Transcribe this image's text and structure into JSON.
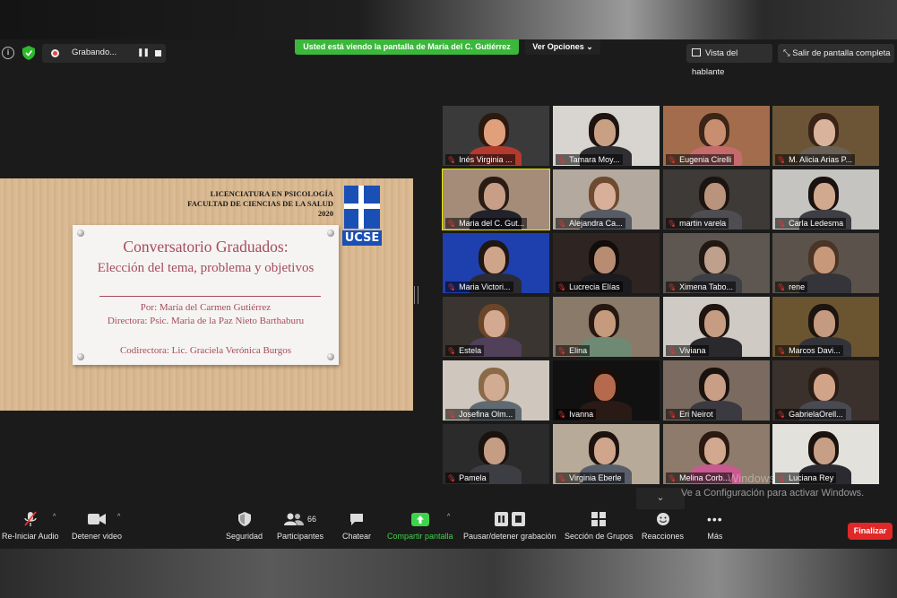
{
  "top_bar": {
    "recording_label": "Grabando...",
    "viewing_banner": "Usted está viendo la pantalla de María del C. Gutiérrez",
    "view_options": "Ver Opciones",
    "speaker_view": "Vista del hablante",
    "exit_fullscreen": "Salir de pantalla completa"
  },
  "slide": {
    "header_line1": "LICENCIATURA EN PSICOLOGÍA",
    "header_line2": "FACULTAD DE CIENCIAS DE LA SALUD",
    "header_year": "2020",
    "logo_text": "UCSE",
    "title": "Conversatorio Graduados:",
    "subtitle": "Elección del tema, problema y objetivos",
    "author": "Por: María del Carmen Gutiérrez",
    "director": "Directora: Psic. Maria de la Paz Nieto Barthaburu",
    "codirector": "Codirectora: Lic. Graciela Verónica Burgos"
  },
  "participants": [
    {
      "name": "Inés Virginia ...",
      "bg": "#3a3a3a",
      "skin": "#e1a07c",
      "hair": "#2b1a10",
      "shirt": "#b23a2f",
      "active": false
    },
    {
      "name": "Tamara Moy...",
      "bg": "#d8d4cf",
      "skin": "#caa085",
      "hair": "#1d1410",
      "shirt": "#2f2f33",
      "active": false
    },
    {
      "name": "Eugenia Cirelli",
      "bg": "#a36d4d",
      "skin": "#c78e70",
      "hair": "#3b2418",
      "shirt": "#c66b6b",
      "active": false
    },
    {
      "name": "M. Alicia Arias P...",
      "bg": "#6c5536",
      "skin": "#d9b39b",
      "hair": "#3a2418",
      "shirt": "#6a6055",
      "active": false
    },
    {
      "name": "Maria del C. Gut...",
      "bg": "#a58c78",
      "skin": "#c89e87",
      "hair": "#2a1c15",
      "shirt": "#22222a",
      "active": true
    },
    {
      "name": "Alejandra Ca...",
      "bg": "#b4a99e",
      "skin": "#d8b09a",
      "hair": "#6e4a30",
      "shirt": "#575b66",
      "active": false
    },
    {
      "name": "martin varela",
      "bg": "#3d3a38",
      "skin": "#b9937c",
      "hair": "#1c1410",
      "shirt": "#4d4d52",
      "active": false
    },
    {
      "name": "Carla Ledesma",
      "bg": "#c6c4c0",
      "skin": "#d1a98f",
      "hair": "#1a120e",
      "shirt": "#3e3e44",
      "active": false
    },
    {
      "name": "Maria Victori...",
      "bg": "#1e3fae",
      "skin": "#cfa58a",
      "hair": "#201612",
      "shirt": "#2a2a30",
      "active": false
    },
    {
      "name": "Lucrecia Elías",
      "bg": "#2e2522",
      "skin": "#b88c72",
      "hair": "#120c0a",
      "shirt": "#1c1c20",
      "active": false
    },
    {
      "name": "Ximena Tabo...",
      "bg": "#5e5751",
      "skin": "#bfa08d",
      "hair": "#221812",
      "shirt": "#3e3e45",
      "active": false
    },
    {
      "name": "rene",
      "bg": "#5b534b",
      "skin": "#c8987b",
      "hair": "#4a3526",
      "shirt": "#34343a",
      "active": false
    },
    {
      "name": "Estela",
      "bg": "#3a3530",
      "skin": "#d3a991",
      "hair": "#6b4528",
      "shirt": "#50405a",
      "active": false
    },
    {
      "name": "Elina",
      "bg": "#8a7a6a",
      "skin": "#c69a7c",
      "hair": "#251812",
      "shirt": "#6e8a74",
      "active": false
    },
    {
      "name": "Viviana",
      "bg": "#cfcac4",
      "skin": "#c69c83",
      "hair": "#1e1510",
      "shirt": "#2a2a2e",
      "active": false
    },
    {
      "name": "Marcos Davi...",
      "bg": "#6b5430",
      "skin": "#c49a80",
      "hair": "#1c140f",
      "shirt": "#33333a",
      "active": false
    },
    {
      "name": "Josefina Olm...",
      "bg": "#cfc7bd",
      "skin": "#d2ab93",
      "hair": "#8a6a48",
      "shirt": "#606a72",
      "active": false
    },
    {
      "name": "Ivanna",
      "bg": "#111111",
      "skin": "#b56a4e",
      "hair": "#1a0e0a",
      "shirt": "#2a1a16",
      "active": false
    },
    {
      "name": "Eri Neirot",
      "bg": "#7a6a60",
      "skin": "#c89e86",
      "hair": "#1a120e",
      "shirt": "#3a3a40",
      "active": false
    },
    {
      "name": "GabrielaOrell...",
      "bg": "#3a302c",
      "skin": "#d1a48a",
      "hair": "#2b1d16",
      "shirt": "#4a4a52",
      "active": false
    },
    {
      "name": "Pamela",
      "bg": "#2b2b2b",
      "skin": "#c59d83",
      "hair": "#1a120e",
      "shirt": "#3d3d44",
      "active": false
    },
    {
      "name": "Virginia Eberle",
      "bg": "#b8aa98",
      "skin": "#cfa68c",
      "hair": "#1c130e",
      "shirt": "#585e6a",
      "active": false
    },
    {
      "name": "Melina Corb...",
      "bg": "#8e7b6c",
      "skin": "#d2a88e",
      "hair": "#2a1a12",
      "shirt": "#c75a8e",
      "active": false
    },
    {
      "name": "Luciana Rey",
      "bg": "#e3e1dc",
      "skin": "#c79f87",
      "hair": "#1a120e",
      "shirt": "#2a2a30",
      "active": false
    }
  ],
  "windows_notice": {
    "watermark": "Windows",
    "text": "Ve a Configuración para activar Windows."
  },
  "toolbar": {
    "audio_label": "Re-Iniciar Audio",
    "video_label": "Detener video",
    "security_label": "Seguridad",
    "participants_label": "Participantes",
    "participants_count": "66",
    "chat_label": "Chatear",
    "share_label": "Compartir pantalla",
    "pause_record_label": "Pausar/detener grabación",
    "breakout_label": "Sección de Grupos",
    "reactions_label": "Reacciones",
    "more_label": "Más",
    "end_label": "Finalizar"
  },
  "colors": {
    "share_green": "#3bb83b",
    "end_red": "#e02828",
    "active_speaker": "#e6e600",
    "slide_text": "#a64b5c"
  }
}
